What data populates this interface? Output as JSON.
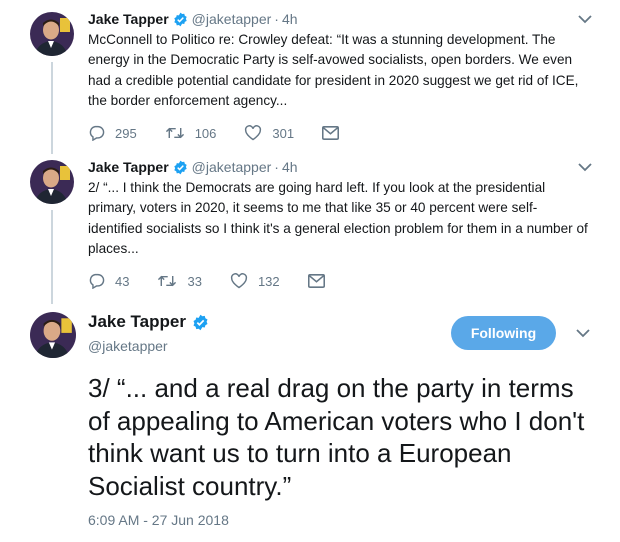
{
  "tweets": [
    {
      "name": "Jake Tapper",
      "handle": "@jaketapper",
      "dot": "·",
      "time": "4h",
      "text": "McConnell to Politico re: Crowley defeat: “It was a stunning development.  The energy in the Democratic Party is self-avowed socialists, open borders.  We even had a credible potential candidate for president in 2020 suggest we get rid of ICE, the border enforcement agency...",
      "replies": "295",
      "retweets": "106",
      "likes": "301"
    },
    {
      "name": "Jake Tapper",
      "handle": "@jaketapper",
      "dot": "·",
      "time": "4h",
      "text": "2/ “... I think the Democrats are going hard left.  If you look at the presidential primary, voters in 2020, it seems to me that like 35 or 40 percent were self-identified socialists so I think it's a general election problem for them in a number of places...",
      "replies": "43",
      "retweets": "33",
      "likes": "132"
    }
  ],
  "main": {
    "name": "Jake Tapper",
    "handle": "@jaketapper",
    "follow_label": "Following",
    "text": "3/ “... and a real drag on the party in terms of appealing to American voters who I don't think want us to turn into a European Socialist country.”",
    "timestamp": "6:09 AM - 27 Jun 2018"
  },
  "colors": {
    "accent": "#1da1f2",
    "following_bg": "#5aa8e8",
    "muted": "#657786",
    "thread_line": "#ccd6dd"
  }
}
